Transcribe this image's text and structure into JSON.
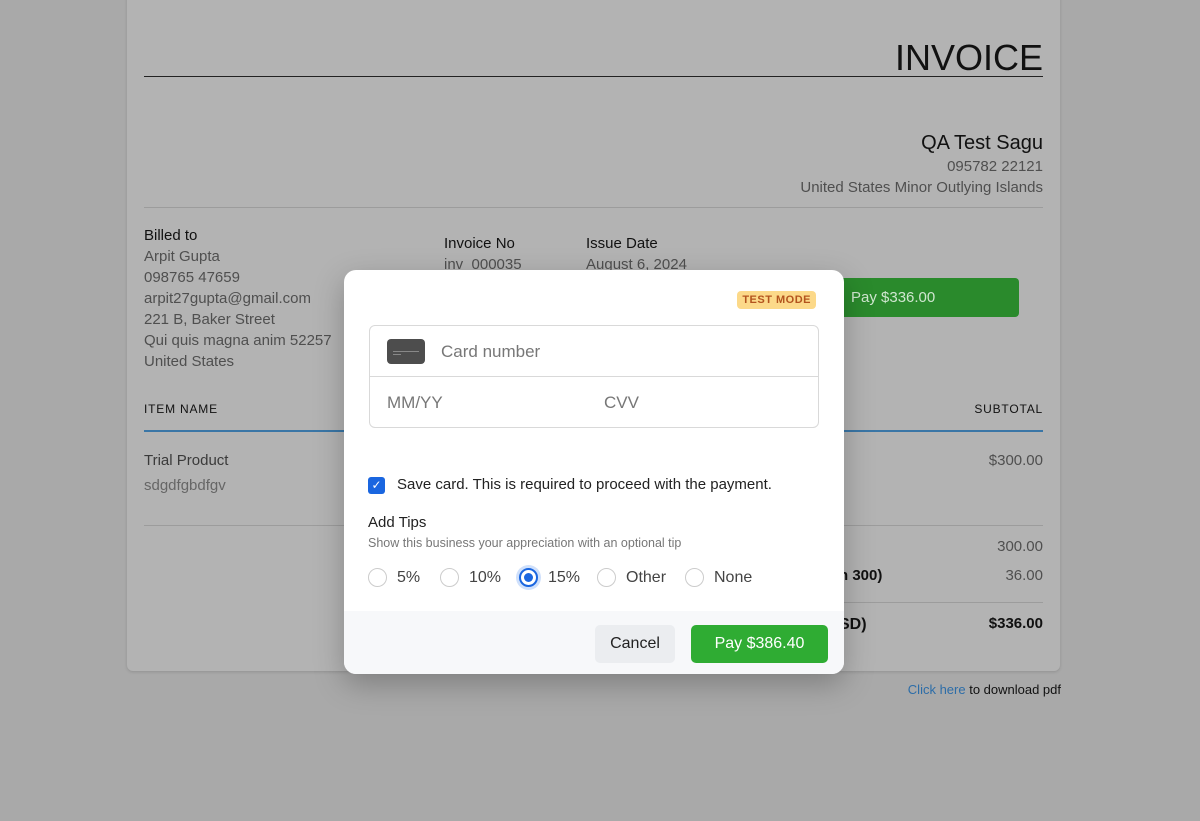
{
  "invoice": {
    "title": "INVOICE",
    "company": {
      "name": "QA Test Sagu",
      "phone": "095782 22121",
      "country": "United States Minor Outlying Islands"
    },
    "billed_to": {
      "label": "Billed to",
      "name": "Arpit Gupta",
      "phone": "098765 47659",
      "email": "arpit27gupta@gmail.com",
      "address1": "221 B, Baker Street",
      "address2": "Qui quis magna anim 52257",
      "country": "United States"
    },
    "invoice_no_label": "Invoice No",
    "invoice_no": "inv_000035",
    "issue_date_label": "Issue Date",
    "issue_date": "August 6, 2024",
    "pay_button": "Pay $336.00",
    "table": {
      "col_item": "ITEM NAME",
      "col_subtotal": "SUBTOTAL",
      "items": [
        {
          "name": "Trial Product",
          "desc": "sdgdfgbdfgv",
          "subtotal": "$300.00"
        }
      ]
    },
    "summary": {
      "subtotal": "300.00",
      "tax_label_partial": "n 300)",
      "tax": "36.00",
      "total_label_partial": "SD)",
      "total": "$336.00"
    },
    "download": {
      "link": "Click here",
      "text": " to download pdf"
    }
  },
  "modal": {
    "badge": "TEST MODE",
    "card_placeholder": "Card number",
    "expiry_placeholder": "MM/YY",
    "cvv_placeholder": "CVV",
    "save_card_label": "Save card. This is required to proceed with the payment.",
    "save_card_checked": true,
    "tips_title": "Add Tips",
    "tips_subtitle": "Show this business your appreciation with an optional tip",
    "tips": [
      {
        "label": "5%",
        "selected": false
      },
      {
        "label": "10%",
        "selected": false
      },
      {
        "label": "15%",
        "selected": true
      },
      {
        "label": "Other",
        "selected": false
      },
      {
        "label": "None",
        "selected": false
      }
    ],
    "cancel": "Cancel",
    "pay": "Pay $386.40"
  },
  "colors": {
    "accent": "#1a66e0",
    "pay_green": "#2fac33",
    "badge_bg": "#fcd989"
  }
}
